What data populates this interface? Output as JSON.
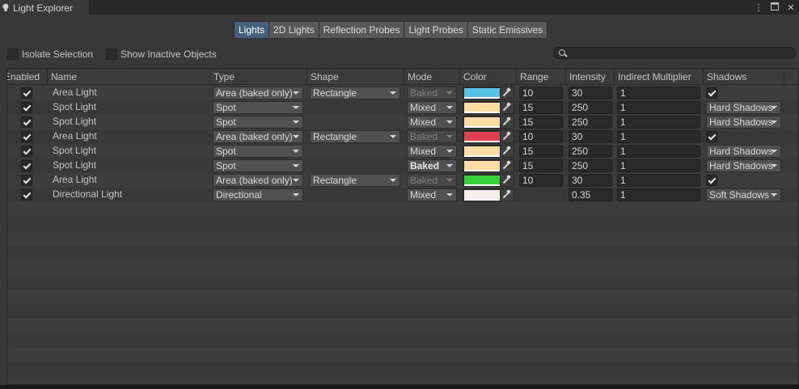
{
  "window": {
    "title": "Light Explorer",
    "icons": [
      "more-icon",
      "maximize-icon",
      "close-icon"
    ]
  },
  "toolbar": {
    "tabs": [
      {
        "label": "Lights",
        "active": true
      },
      {
        "label": "2D Lights",
        "active": false
      },
      {
        "label": "Reflection Probes",
        "active": false
      },
      {
        "label": "Light Probes",
        "active": false
      },
      {
        "label": "Static Emissives",
        "active": false
      }
    ]
  },
  "options": {
    "isolate_selection": "Isolate Selection",
    "show_inactive": "Show Inactive Objects",
    "search_placeholder": ""
  },
  "table": {
    "columns": [
      "Enabled",
      "Name",
      "Type",
      "Shape",
      "Mode",
      "Color",
      "Range",
      "Intensity",
      "Indirect Multiplier",
      "Shadows"
    ],
    "rows": [
      {
        "enabled": true,
        "name": "Area Light",
        "type": "Area (baked only)",
        "shape": "Rectangle",
        "mode": "Baked",
        "mode_state": "disabled",
        "color": "#56c3e6",
        "range": "10",
        "intensity": "30",
        "indirect": "1",
        "shadows": "",
        "shadows_checkbox": true
      },
      {
        "enabled": true,
        "name": "Spot Light",
        "type": "Spot",
        "shape": "",
        "mode": "Mixed",
        "mode_state": "normal",
        "color": "#ffdda4",
        "range": "15",
        "intensity": "250",
        "indirect": "1",
        "shadows": "Hard Shadows",
        "shadows_checkbox": false
      },
      {
        "enabled": true,
        "name": "Spot Light",
        "type": "Spot",
        "shape": "",
        "mode": "Mixed",
        "mode_state": "normal",
        "color": "#ffdda4",
        "range": "15",
        "intensity": "250",
        "indirect": "1",
        "shadows": "Hard Shadows",
        "shadows_checkbox": false
      },
      {
        "enabled": true,
        "name": "Area Light",
        "type": "Area (baked only)",
        "shape": "Rectangle",
        "mode": "Baked",
        "mode_state": "disabled",
        "color": "#e04050",
        "range": "10",
        "intensity": "30",
        "indirect": "1",
        "shadows": "",
        "shadows_checkbox": true
      },
      {
        "enabled": true,
        "name": "Spot Light",
        "type": "Spot",
        "shape": "",
        "mode": "Mixed",
        "mode_state": "normal",
        "color": "#ffdda4",
        "range": "15",
        "intensity": "250",
        "indirect": "1",
        "shadows": "Hard Shadows",
        "shadows_checkbox": false
      },
      {
        "enabled": true,
        "name": "Spot Light",
        "type": "Spot",
        "shape": "",
        "mode": "Baked",
        "mode_state": "bold",
        "color": "#ffdda4",
        "range": "15",
        "intensity": "250",
        "indirect": "1",
        "shadows": "Hard Shadows",
        "shadows_checkbox": false
      },
      {
        "enabled": true,
        "name": "Area Light",
        "type": "Area (baked only)",
        "shape": "Rectangle",
        "mode": "Baked",
        "mode_state": "disabled",
        "color": "#38d038",
        "range": "10",
        "intensity": "30",
        "indirect": "1",
        "shadows": "",
        "shadows_checkbox": true
      },
      {
        "enabled": true,
        "name": "Directional Light",
        "type": "Directional",
        "shape": "",
        "mode": "Mixed",
        "mode_state": "normal",
        "color": "#f4efe8",
        "range": "",
        "intensity": "0.35",
        "indirect": "1",
        "shadows": "Soft Shadows",
        "shadows_checkbox": false
      }
    ]
  }
}
